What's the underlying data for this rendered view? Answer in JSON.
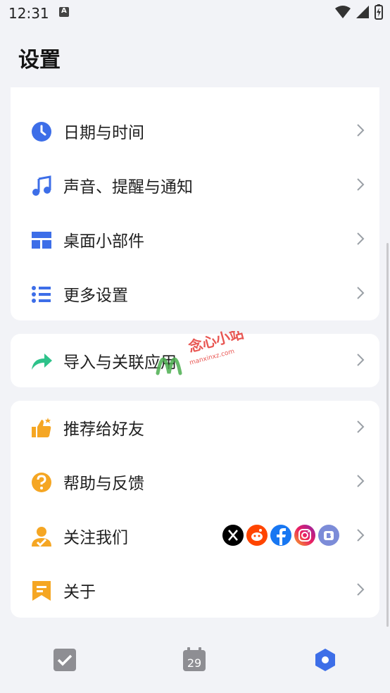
{
  "status": {
    "time": "12:31",
    "notif_letter": "A"
  },
  "page": {
    "title": "设置"
  },
  "group1": [
    {
      "label": "日期与时间",
      "icon": "clock-icon"
    },
    {
      "label": "声音、提醒与通知",
      "icon": "music-note-icon"
    },
    {
      "label": "桌面小部件",
      "icon": "widget-icon"
    },
    {
      "label": "更多设置",
      "icon": "list-settings-icon"
    }
  ],
  "group2": [
    {
      "label": "导入与关联应用",
      "icon": "share-arrow-icon"
    }
  ],
  "group3": [
    {
      "label": "推荐给好友",
      "icon": "thumbs-up-icon"
    },
    {
      "label": "帮助与反馈",
      "icon": "help-icon"
    },
    {
      "label": "关注我们",
      "icon": "user-follow-icon"
    },
    {
      "label": "关于",
      "icon": "bookmark-flag-icon"
    }
  ],
  "social": [
    "x-icon",
    "reddit-icon",
    "facebook-icon",
    "instagram-icon",
    "bilibili-icon"
  ],
  "bottom_nav": {
    "calendar_day": "29"
  },
  "watermark": {
    "text": "念心小站",
    "url": "manxinxz.com"
  },
  "colors": {
    "accent": "#3d6ee8",
    "orange": "#f5a623",
    "green": "#2ec28a"
  }
}
